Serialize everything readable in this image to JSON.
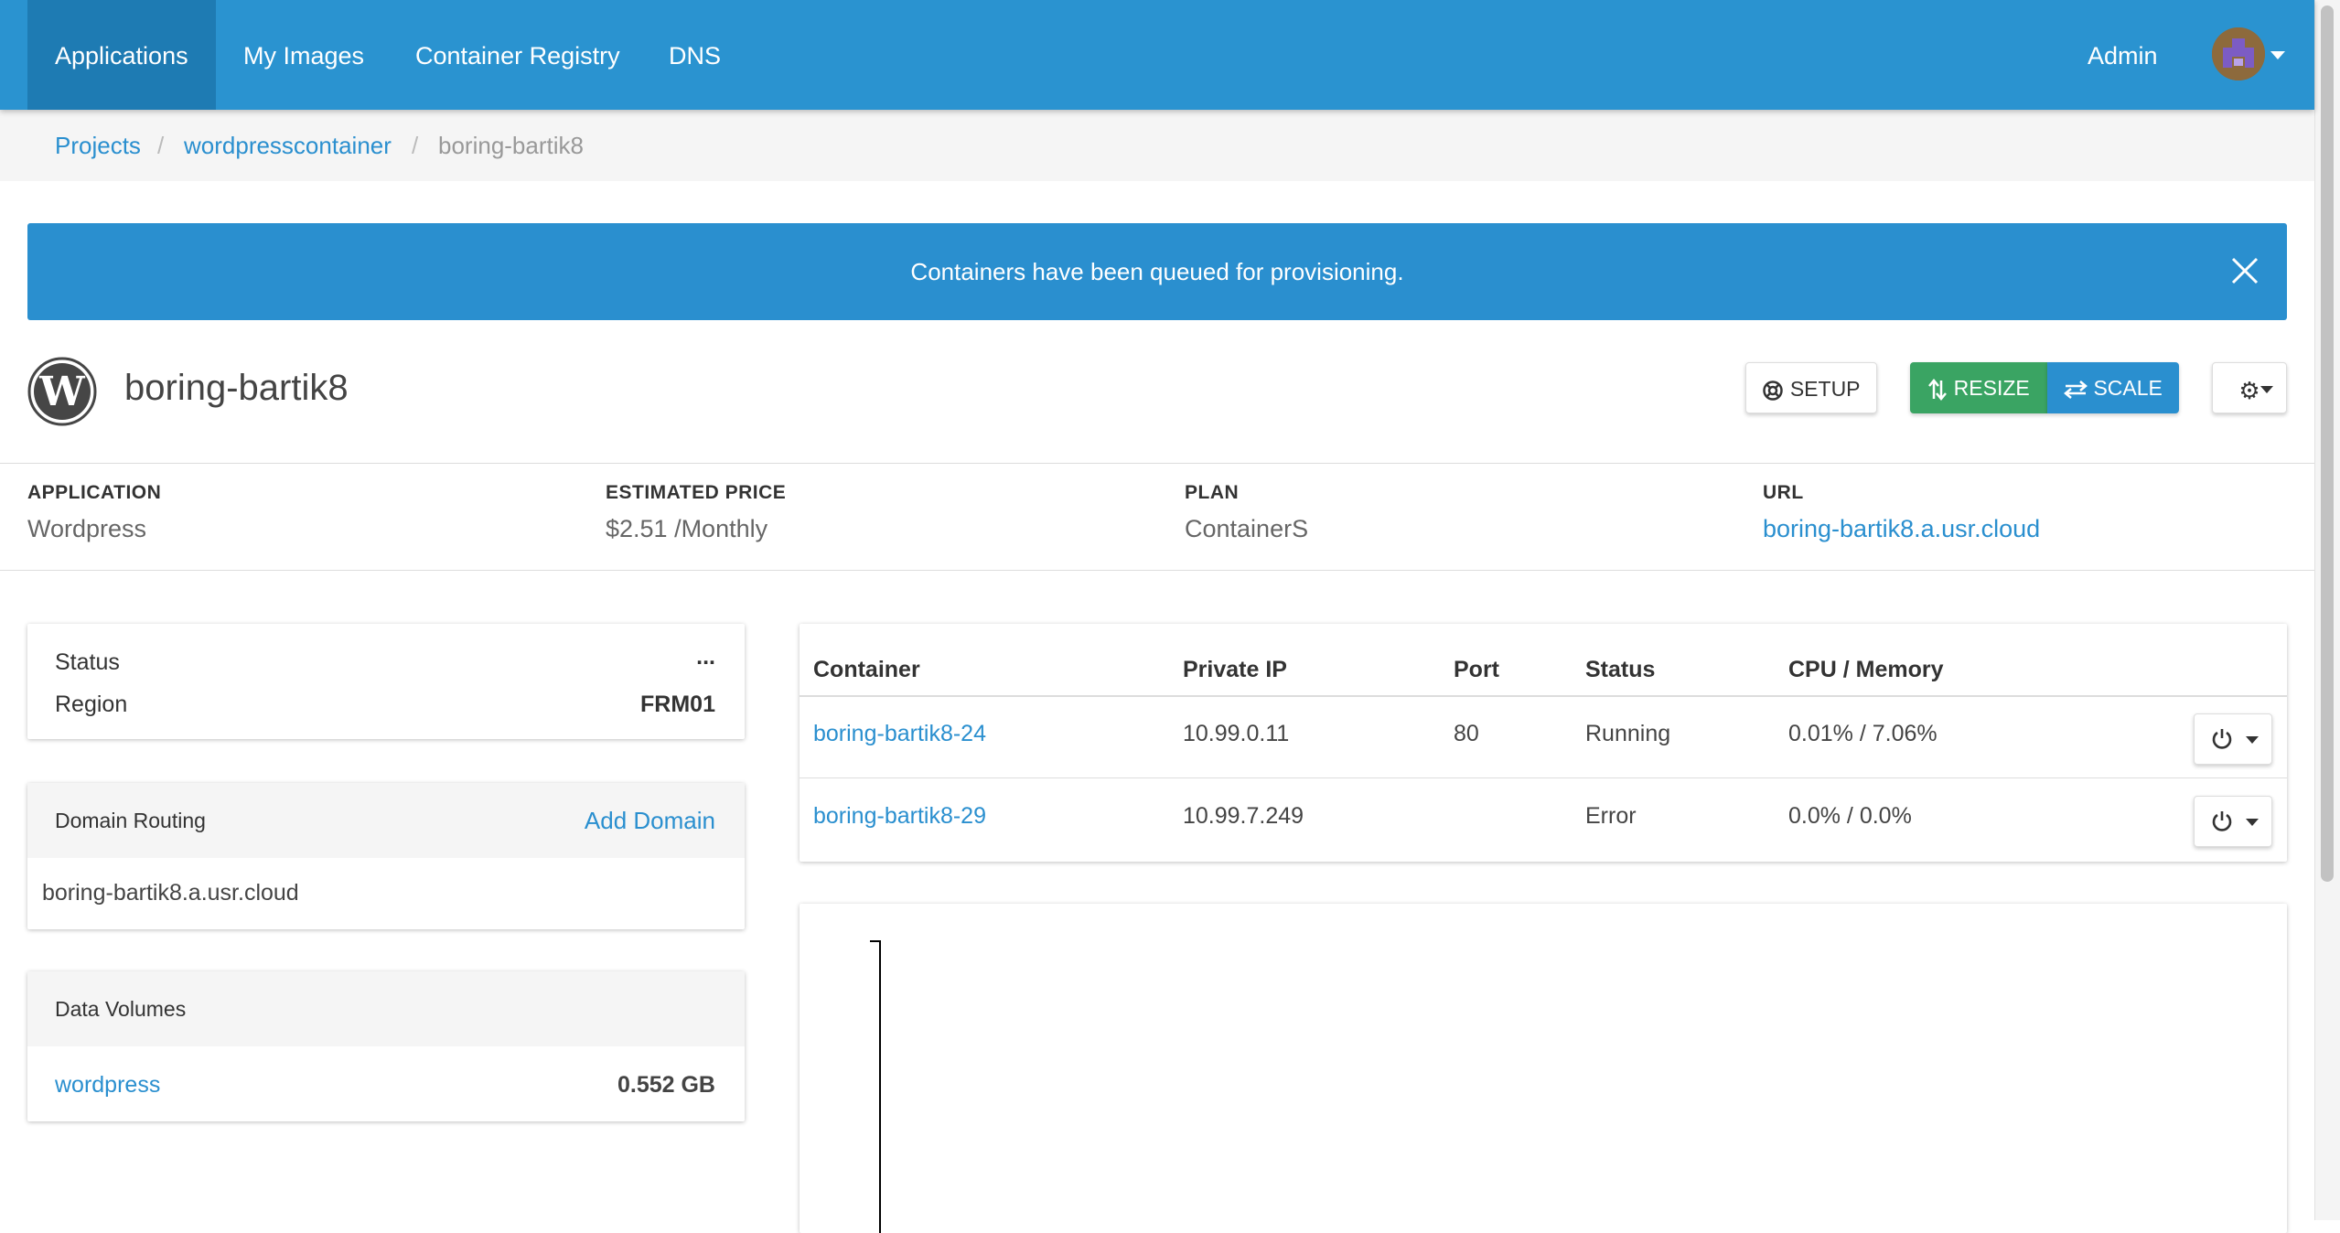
{
  "nav": {
    "items": [
      "Applications",
      "My Images",
      "Container Registry",
      "DNS"
    ],
    "admin": "Admin"
  },
  "breadcrumb": {
    "projects": "Projects",
    "project": "wordpresscontainer",
    "current": "boring-bartik8"
  },
  "alert": {
    "message": "Containers have been queued for provisioning."
  },
  "app": {
    "name": "boring-bartik8",
    "buttons": {
      "setup": "SETUP",
      "resize": "RESIZE",
      "scale": "SCALE"
    }
  },
  "info": {
    "application": {
      "label": "APPLICATION",
      "value": "Wordpress"
    },
    "price": {
      "label": "ESTIMATED PRICE",
      "value": "$2.51 /Monthly"
    },
    "plan": {
      "label": "PLAN",
      "value": "ContainerS"
    },
    "url": {
      "label": "URL",
      "value": "boring-bartik8.a.usr.cloud"
    }
  },
  "status_card": {
    "status_label": "Status",
    "status_value": "...",
    "region_label": "Region",
    "region_value": "FRM01"
  },
  "domain_card": {
    "title": "Domain Routing",
    "add": "Add Domain",
    "domain": "boring-bartik8.a.usr.cloud"
  },
  "volumes_card": {
    "title": "Data Volumes",
    "volume": "wordpress",
    "size": "0.552 GB"
  },
  "containers": {
    "headers": [
      "Container",
      "Private IP",
      "Port",
      "Status",
      "CPU / Memory"
    ],
    "rows": [
      {
        "name": "boring-bartik8-24",
        "ip": "10.99.0.11",
        "port": "80",
        "status": "Running",
        "usage": "0.01% / 7.06%"
      },
      {
        "name": "boring-bartik8-29",
        "ip": "10.99.7.249",
        "port": "",
        "status": "Error",
        "usage": "0.0% / 0.0%"
      }
    ]
  },
  "colors": {
    "primary": "#2a93d0",
    "success": "#3aa463",
    "link": "#2a8fcf"
  }
}
